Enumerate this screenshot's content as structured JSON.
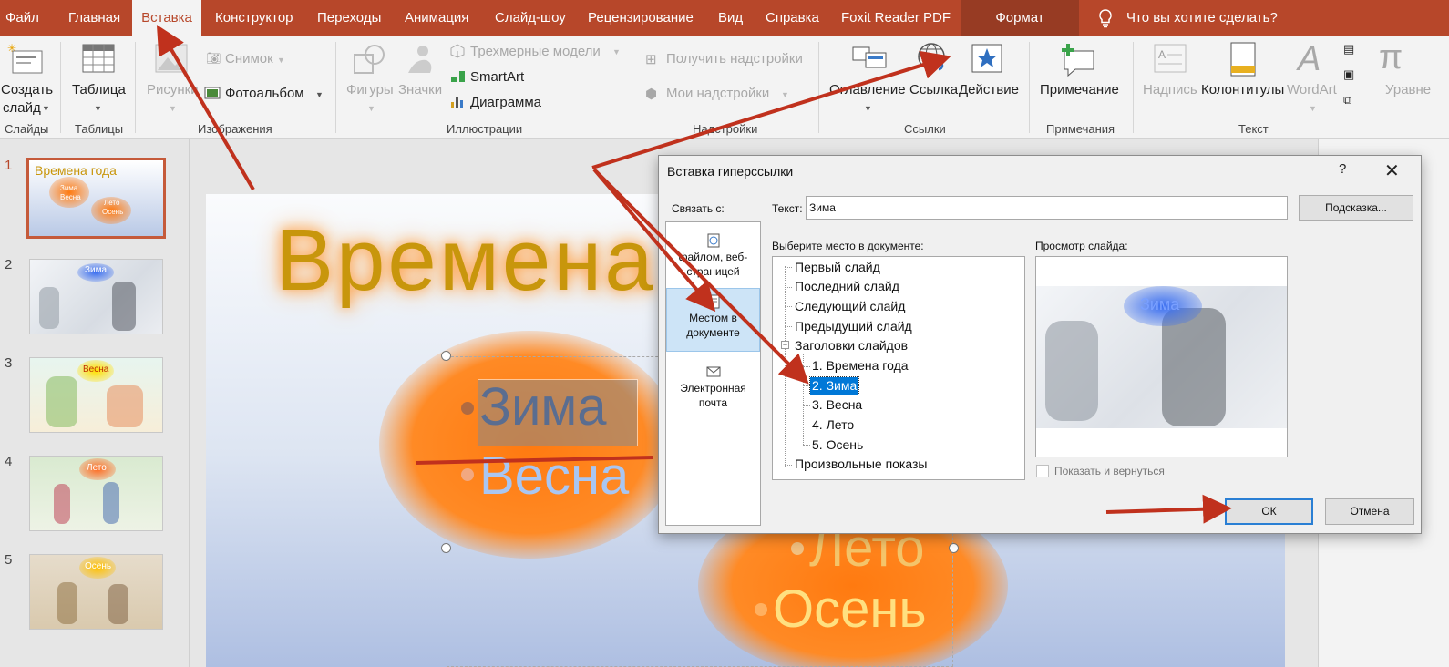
{
  "tabs": [
    "Файл",
    "Главная",
    "Вставка",
    "Конструктор",
    "Переходы",
    "Анимация",
    "Слайд-шоу",
    "Рецензирование",
    "Вид",
    "Справка",
    "Foxit Reader PDF"
  ],
  "active_tab": "Вставка",
  "format_tab": "Формат",
  "tell_me": "Что вы хотите сделать?",
  "ribbon": {
    "slides": {
      "new_slide_1": "Создать",
      "new_slide_2": "слайд",
      "group": "Слайды"
    },
    "tables": {
      "table": "Таблица",
      "group": "Таблицы"
    },
    "images": {
      "pictures": "Рисунки",
      "screenshot": "Снимок",
      "album": "Фотоальбом",
      "group": "Изображения"
    },
    "illustrations": {
      "shapes": "Фигуры",
      "icons": "Значки",
      "models": "Трехмерные модели",
      "smartart": "SmartArt",
      "chart": "Диаграмма",
      "group": "Иллюстрации"
    },
    "addins": {
      "get": "Получить надстройки",
      "my": "Мои надстройки",
      "group": "Надстройки"
    },
    "links": {
      "zoom": "Оглавление",
      "link": "Ссылка",
      "action": "Действие",
      "group": "Ссылки"
    },
    "comments": {
      "comment": "Примечание",
      "group": "Примечания"
    },
    "text": {
      "textbox": "Надпись",
      "header": "Колонтитулы",
      "wordart": "WordArt",
      "group": "Текст"
    },
    "equations": {
      "label": "Уравне"
    }
  },
  "thumbnails": [
    {
      "num": "1",
      "title": "Времена года",
      "items": [
        "Зима",
        "Весна",
        "Лето",
        "Осень"
      ]
    },
    {
      "num": "2",
      "title": "Зима"
    },
    {
      "num": "3",
      "title": "Весна"
    },
    {
      "num": "4",
      "title": "Лето"
    },
    {
      "num": "5",
      "title": "Осень"
    }
  ],
  "slide": {
    "title": "Времена года",
    "bullets": [
      "Зима",
      "Весна",
      "Лето",
      "Осень"
    ]
  },
  "dialog": {
    "title": "Вставка гиперссылки",
    "help": "?",
    "close": "✕",
    "link_to": "Связать с:",
    "link_options": [
      {
        "label": "файлом, веб-страницей"
      },
      {
        "label": "Местом в документе"
      },
      {
        "label": "Электронная почта"
      }
    ],
    "text_label": "Текст:",
    "text_value": "Зима",
    "hint_button": "Подсказка...",
    "place_label": "Выберите место в документе:",
    "tree": [
      "Первый слайд",
      "Последний слайд",
      "Следующий слайд",
      "Предыдущий слайд",
      "Заголовки слайдов",
      "1. Времена года",
      "2. Зима",
      "3. Весна",
      "4. Лето",
      "5. Осень",
      "Произвольные показы"
    ],
    "selected_item": "2. Зима",
    "preview_label": "Просмотр слайда:",
    "preview_title": "Зима",
    "show_return": "Показать и вернуться",
    "ok": "ОК",
    "cancel": "Отмена"
  },
  "colors": {
    "accent": "#b7472a",
    "selection": "#0078d7",
    "arrow": "#c0311d"
  }
}
